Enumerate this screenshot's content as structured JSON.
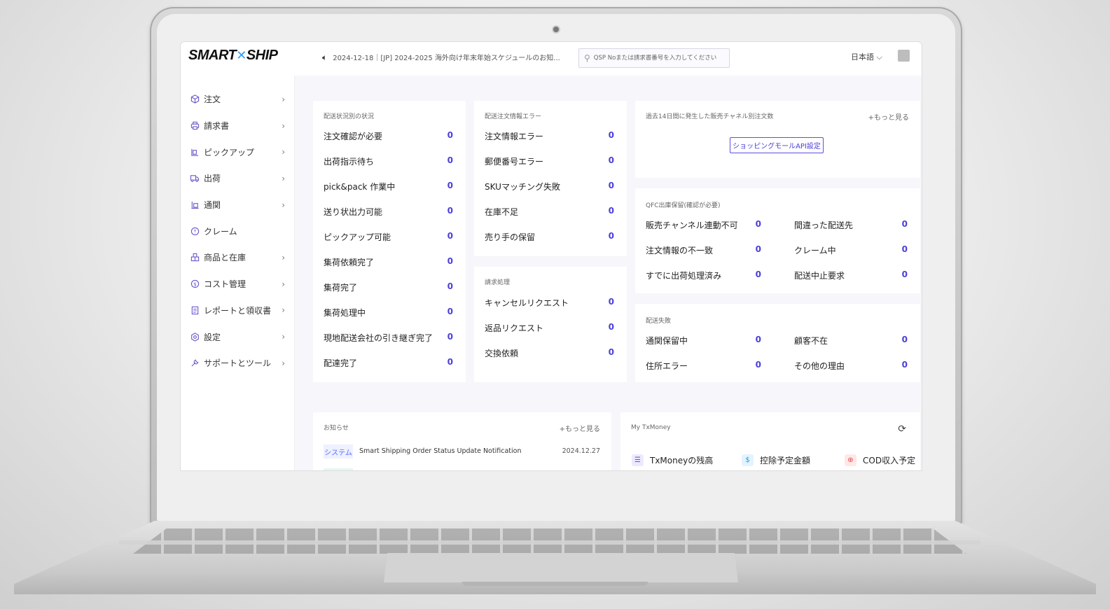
{
  "brand": {
    "logo_left": "SMART",
    "logo_x": "✕",
    "logo_right": "SHIP"
  },
  "sidebar": {
    "items": [
      {
        "label": "注文",
        "icon": "box-icon",
        "has_children": true
      },
      {
        "label": "請求書",
        "icon": "printer-icon",
        "has_children": true
      },
      {
        "label": "ピックアップ",
        "icon": "pickup-icon",
        "has_children": true
      },
      {
        "label": "出荷",
        "icon": "truck-icon",
        "has_children": true
      },
      {
        "label": "通関",
        "icon": "customs-icon",
        "has_children": true
      },
      {
        "label": "クレーム",
        "icon": "alert-circle-icon",
        "has_children": false
      },
      {
        "label": "商品と在庫",
        "icon": "inventory-icon",
        "has_children": true
      },
      {
        "label": "コスト管理",
        "icon": "cost-icon",
        "has_children": true
      },
      {
        "label": "レポートと領収書",
        "icon": "report-icon",
        "has_children": true
      },
      {
        "label": "設定",
        "icon": "settings-icon",
        "has_children": true
      },
      {
        "label": "サポートとツール",
        "icon": "tools-icon",
        "has_children": true
      }
    ]
  },
  "header": {
    "notice": "2024-12-18｜[JP] 2024-2025 海外向け年末年始スケジュールのお知...",
    "search_placeholder": "QSP Noまたは請求書番号を入力してください",
    "language": "日本語 ⌵"
  },
  "shipping_status": {
    "title": "配送状況別の状況",
    "rows": [
      {
        "label": "注文確認が必要",
        "value": "0"
      },
      {
        "label": "出荷指示待ち",
        "value": "0"
      },
      {
        "label": "pick&pack 作業中",
        "value": "0"
      },
      {
        "label": "送り状出力可能",
        "value": "0"
      },
      {
        "label": "ピックアップ可能",
        "value": "0"
      },
      {
        "label": "集荷依頼完了",
        "value": "0"
      },
      {
        "label": "集荷完了",
        "value": "0"
      },
      {
        "label": "集荷処理中",
        "value": "0"
      },
      {
        "label": "現地配送会社の引き継ぎ完了",
        "value": "0"
      },
      {
        "label": "配達完了",
        "value": "0"
      }
    ]
  },
  "order_errors": {
    "title": "配送注文情報エラー",
    "rows": [
      {
        "label": "注文情報エラー",
        "value": "0"
      },
      {
        "label": "郵便番号エラー",
        "value": "0"
      },
      {
        "label": "SKUマッチング失敗",
        "value": "0"
      },
      {
        "label": "在庫不足",
        "value": "0"
      },
      {
        "label": "売り手の保留",
        "value": "0"
      }
    ]
  },
  "claims": {
    "title": "請求処理",
    "rows": [
      {
        "label": "キャンセルリクエスト",
        "value": "0"
      },
      {
        "label": "返品リクエスト",
        "value": "0"
      },
      {
        "label": "交換依頼",
        "value": "0"
      }
    ]
  },
  "channel_orders": {
    "title": "過去14日間に発生した販売チャネル別注文数",
    "more": "+もっと見る",
    "button": "ショッピングモールAPI設定"
  },
  "qfc_hold": {
    "title": "QFC出庫保留(確認が必要)",
    "rows": [
      {
        "label": "販売チャンネル連動不可",
        "value": "0"
      },
      {
        "label": "間違った配送先",
        "value": "0"
      },
      {
        "label": "注文情報の不一致",
        "value": "0"
      },
      {
        "label": "クレーム中",
        "value": "0"
      },
      {
        "label": "すでに出荷処理済み",
        "value": "0"
      },
      {
        "label": "配送中止要求",
        "value": "0"
      }
    ]
  },
  "delivery_fail": {
    "title": "配送失敗",
    "rows": [
      {
        "label": "通関保留中",
        "value": "0"
      },
      {
        "label": "顧客不在",
        "value": "0"
      },
      {
        "label": "住所エラー",
        "value": "0"
      },
      {
        "label": "その他の理由",
        "value": "0"
      }
    ]
  },
  "news": {
    "title": "お知らせ",
    "more": "+もっと見る",
    "items": [
      {
        "tag": "システム",
        "text": "Smart Shipping Order Status Update Notification",
        "date": "2024.12.27"
      }
    ]
  },
  "txmoney": {
    "title": "My TxMoney",
    "items": [
      {
        "label": "TxMoneyの残高",
        "icon": "database-icon"
      },
      {
        "label": "控除予定金額",
        "icon": "dollar-icon"
      },
      {
        "label": "COD収入予定",
        "icon": "plus-circle-icon"
      }
    ]
  },
  "colors": {
    "accent": "#4b3fd8",
    "logo_x": "#2f9bff"
  }
}
